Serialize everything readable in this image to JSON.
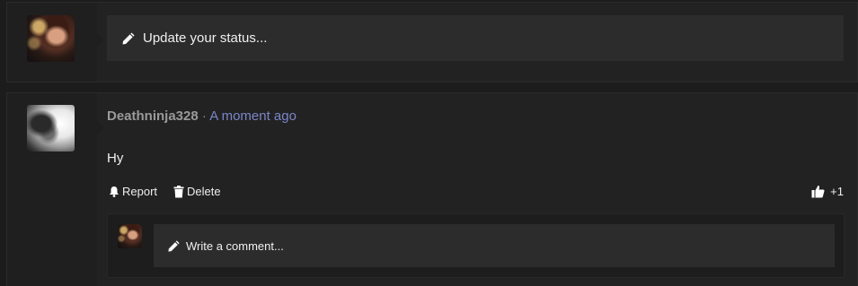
{
  "composer": {
    "placeholder": "Update your status..."
  },
  "post": {
    "author": "Deathninja328",
    "separator": "·",
    "time": "A moment ago",
    "body": "Hy",
    "actions": {
      "report": "Report",
      "delete": "Delete"
    },
    "like_count": "+1"
  },
  "comment": {
    "placeholder": "Write a comment..."
  },
  "icons": {
    "edit": "pencil-icon",
    "report": "bell-icon",
    "delete": "trash-icon",
    "like": "thumbs-up-icon"
  },
  "colors": {
    "timestamp": "#7b86c8",
    "author": "#9a9a9a",
    "input_bg": "#2c2c2c"
  }
}
